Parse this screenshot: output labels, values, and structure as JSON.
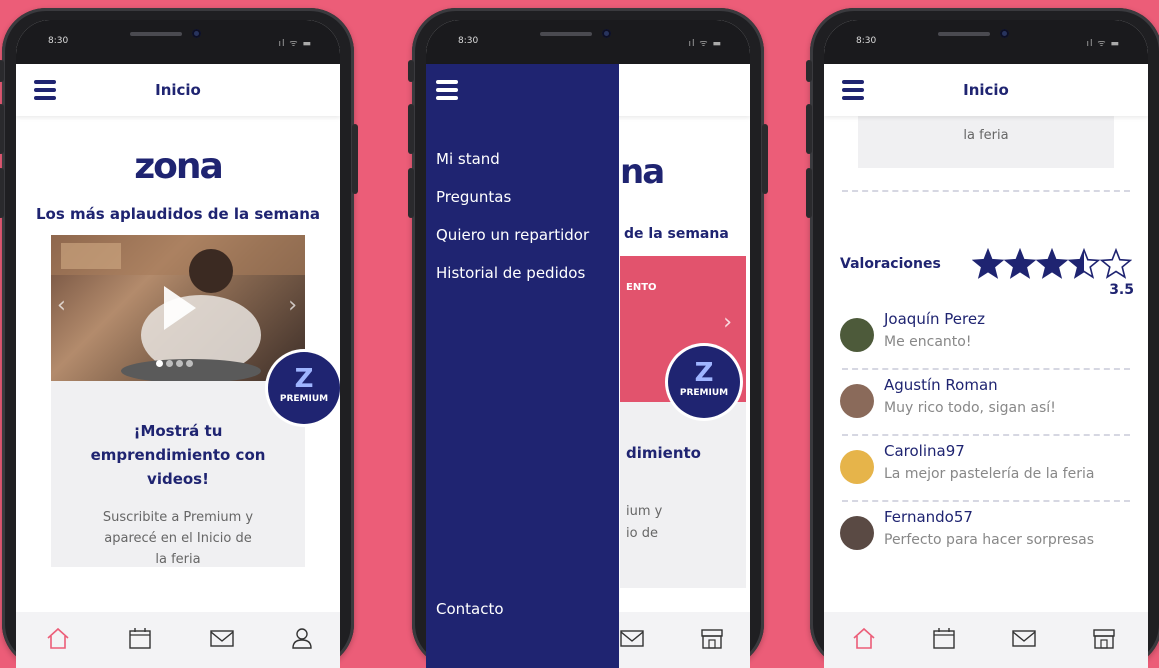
{
  "status_time": "8:30",
  "screen1": {
    "title": "Inicio",
    "logo": "zona",
    "heading": "Los más aplaudidos de la semana",
    "badge_label": "PREMIUM",
    "promo_title": "¡Mostrá tu emprendimiento con videos!",
    "promo_text": "Suscribite a Premium y aparecé en el Inicio de la feria"
  },
  "screen2": {
    "menu": [
      "Mi stand",
      "Preguntas",
      "Quiero un repartidor",
      "Historial de pedidos"
    ],
    "contact": "Contacto",
    "peek_logo": "na",
    "peek_heading": "de la semana",
    "peek_banner": "ENTO",
    "peek_promo_title": "dimiento",
    "peek_promo_l1": "ium y",
    "peek_promo_l2": "io de",
    "badge_label": "PREMIUM"
  },
  "screen3": {
    "title": "Inicio",
    "top_text": "la feria",
    "ratings_label": "Valoraciones",
    "rating_value": "3.5",
    "rating": 3.5,
    "reviews": [
      {
        "name": "Joaquín Perez",
        "text": "Me encanto!"
      },
      {
        "name": "Agustín Roman",
        "text": "Muy rico todo, sigan así!"
      },
      {
        "name": "Carolina97",
        "text": "La mejor pastelería de la feria"
      },
      {
        "name": "Fernando57",
        "text": "Perfecto para hacer sorpresas"
      }
    ]
  },
  "colors": {
    "brand": "#1f2471",
    "background": "#ec5d78",
    "accent_home": "#ec5d78"
  },
  "icons": [
    "menu-icon",
    "home-icon",
    "calendar-icon",
    "mail-icon",
    "user-icon",
    "store-icon",
    "star-icon",
    "play-icon"
  ]
}
